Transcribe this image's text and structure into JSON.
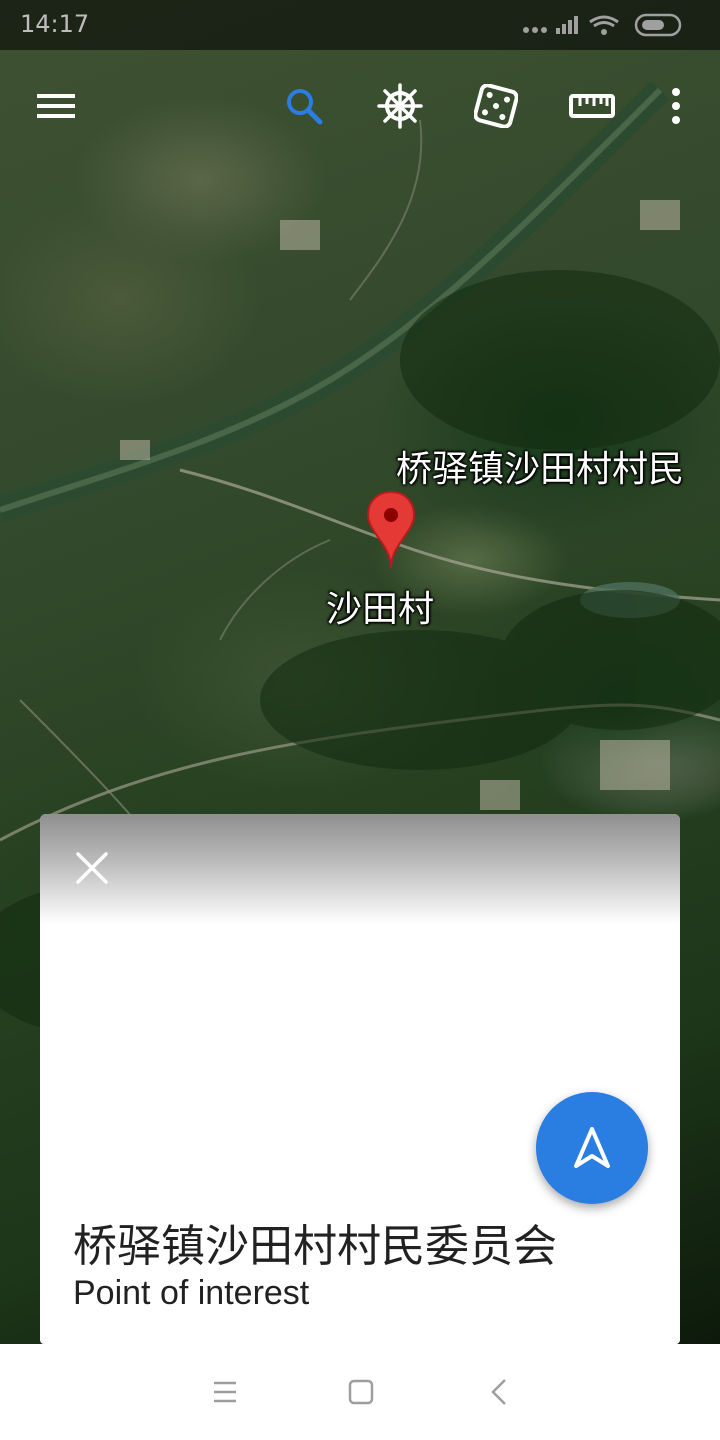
{
  "status": {
    "time": "14:17"
  },
  "toolbar": {
    "icons": [
      "menu-icon",
      "search-icon",
      "ship-wheel-icon",
      "dice-icon",
      "ruler-icon",
      "more-vert-icon"
    ]
  },
  "map": {
    "poi_label": "桥驿镇沙田村村民",
    "village_label": "沙田村"
  },
  "card": {
    "title": "桥驿镇沙田村村民委员会",
    "subtitle": "Point of interest"
  },
  "colors": {
    "accent": "#2a7de1",
    "pin": "#e53935",
    "search_icon": "#2a7de1"
  }
}
